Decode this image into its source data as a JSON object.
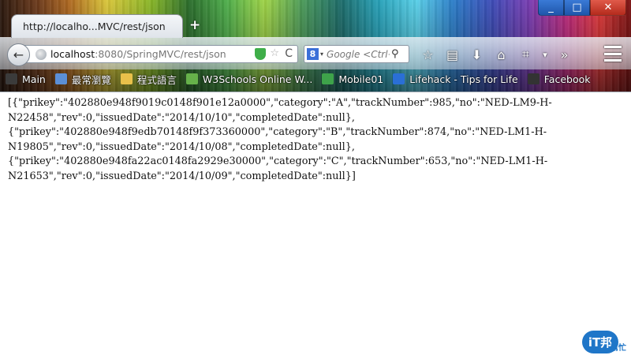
{
  "window": {
    "minimize_label": "_",
    "maximize_label": "□",
    "close_label": "✕"
  },
  "tab": {
    "title": "http://localho...MVC/rest/json",
    "new_tab_label": "+"
  },
  "toolbar": {
    "back_label": "←",
    "url_host": "localhost",
    "url_rest": ":8080/SpringMVC/rest/json",
    "search_engine_letter": "8",
    "search_placeholder": "Google <Ctrl+K>",
    "search_icon": "⚲",
    "reload_icon": "C",
    "bookmark_star": "☆",
    "reading_list_icon": "▤",
    "download_icon": "⬇",
    "home_icon": "⌂",
    "crop_icon": "⌗",
    "dropdown_icon": "▾",
    "overflow_icon": "»",
    "icons": [
      "star-icon",
      "reading-list-icon",
      "download-icon",
      "home-icon",
      "crop-icon",
      "dropdown-icon",
      "overflow-icon"
    ]
  },
  "bookmarks": [
    {
      "label": "Main",
      "color": "#3b3b3b",
      "icon": "folder-icon"
    },
    {
      "label": "最常瀏覽",
      "color": "#5b8fd6",
      "icon": "star-page-icon"
    },
    {
      "label": "程式語言",
      "color": "#e8c04a",
      "icon": "folder-icon"
    },
    {
      "label": "W3Schools Online W...",
      "color": "#66b14a",
      "icon": "w3schools-icon"
    },
    {
      "label": "Mobile01",
      "color": "#3ea34a",
      "icon": "mobile01-icon"
    },
    {
      "label": "Lifehack - Tips for Life",
      "color": "#2a6fd6",
      "icon": "lifehack-icon"
    },
    {
      "label": "Facebook",
      "color": "#333333",
      "icon": "facebook-icon"
    }
  ],
  "page": {
    "json_lines": [
      "[{\"prikey\":\"402880e948f9019c0148f901e12a0000\",\"category\":\"A\",\"trackNumber\":985,\"no\":\"NED-LM9-H-",
      "N22458\",\"rev\":0,\"issuedDate\":\"2014/10/10\",\"completedDate\":null},",
      "{\"prikey\":\"402880e948f9edb70148f9f373360000\",\"category\":\"B\",\"trackNumber\":874,\"no\":\"NED-LM1-H-",
      "N19805\",\"rev\":0,\"issuedDate\":\"2014/10/08\",\"completedDate\":null},",
      "{\"prikey\":\"402880e948fa22ac0148fa2929e30000\",\"category\":\"C\",\"trackNumber\":653,\"no\":\"NED-LM1-H-",
      "N21653\",\"rev\":0,\"issuedDate\":\"2014/10/09\",\"completedDate\":null}]"
    ]
  },
  "watermark": {
    "badge": "iT邦",
    "sub": "幫忙"
  }
}
